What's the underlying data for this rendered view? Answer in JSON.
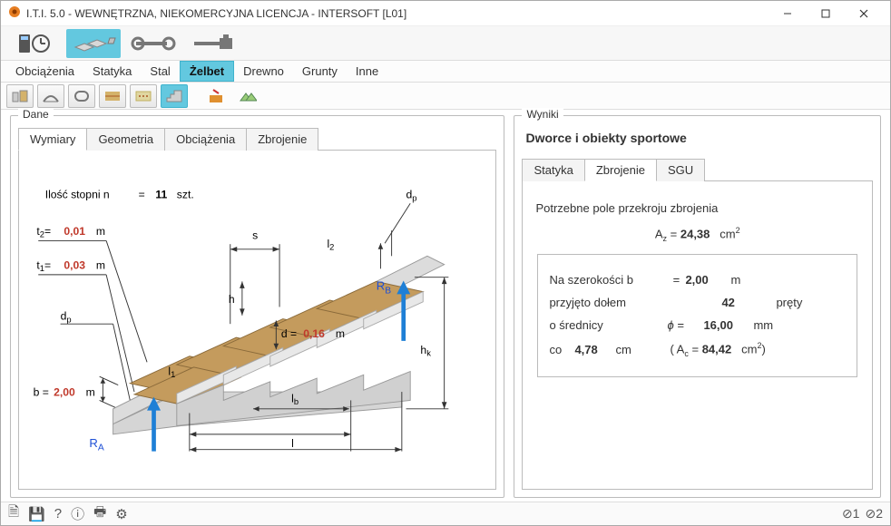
{
  "window": {
    "title": "I.T.I. 5.0 - WEWNĘTRZNA, NIEKOMERCYJNA LICENCJA - INTERSOFT [L01]"
  },
  "menubar": {
    "items": [
      "Obciążenia",
      "Statyka",
      "Stal",
      "Żelbet",
      "Drewno",
      "Grunty",
      "Inne"
    ],
    "active": "Żelbet"
  },
  "dane": {
    "title": "Dane",
    "tabs": [
      "Wymiary",
      "Geometria",
      "Obciążenia",
      "Zbrojenie"
    ],
    "active": "Wymiary",
    "wymiary": {
      "ilosc_label_pre": "Ilość stopni n",
      "ilosc_eq": "=",
      "ilosc_val": "11",
      "ilosc_unit": "szt.",
      "t2_label": "t",
      "t2_sub": "2",
      "t2_eq": "=",
      "t2_val": "0,01",
      "t2_unit": "m",
      "t1_label": "t",
      "t1_sub": "1",
      "t1_eq": "=",
      "t1_val": "0,03",
      "t1_unit": "m",
      "dp_label": "d",
      "dp_sub": "p",
      "b_label": "b =",
      "b_val": "2,00",
      "b_unit": "m",
      "RA": "R",
      "RA_sub": "A",
      "RB": "R",
      "RB_sub": "B",
      "s_label": "s",
      "l2_label": "l",
      "l2_sub": "2",
      "h_label": "h",
      "d_label_pre": "d =",
      "d_val": "0,16",
      "d_unit": "m",
      "l1_label": "l",
      "l1_sub": "1",
      "lb_label": "l",
      "lb_sub": "b",
      "l_label": "l",
      "hk_label": "h",
      "hk_sub": "k",
      "dp2_label": "d",
      "dp2_sub": "p"
    }
  },
  "wyniki": {
    "title": "Wyniki",
    "heading": "Dworce i obiekty sportowe",
    "tabs": [
      "Statyka",
      "Zbrojenie",
      "SGU"
    ],
    "active": "Zbrojenie",
    "zbrojenie": {
      "line1": "Potrzebne pole przekroju zbrojenia",
      "Az_label_pre": "A",
      "Az_sub": "z",
      "Az_eq": "=",
      "Az_val": "24,38",
      "Az_unit_pre": "cm",
      "Az_unit_sup": "2",
      "row1_lbl": "Na szerokości b",
      "row1_eq": "=",
      "row1_val": "2,00",
      "row1_unit": "m",
      "row2_lbl": "przyjęto dołem",
      "row2_val": "42",
      "row2_unit": "pręty",
      "row3_lbl": "o średnicy",
      "row3_sym": "ϕ =",
      "row3_val": "16,00",
      "row3_unit": "mm",
      "row4_lbl_pre": "co",
      "row4_val": "4,78",
      "row4_unit": "cm",
      "row4_paren_pre": "( A",
      "row4_paren_sub": "c",
      "row4_paren_eq": "=",
      "row4_paren_val": "84,42",
      "row4_paren_unit_pre": "cm",
      "row4_paren_unit_sup": "2",
      "row4_paren_close": ")"
    }
  },
  "footer": {
    "status1": "1",
    "status2": "2"
  }
}
